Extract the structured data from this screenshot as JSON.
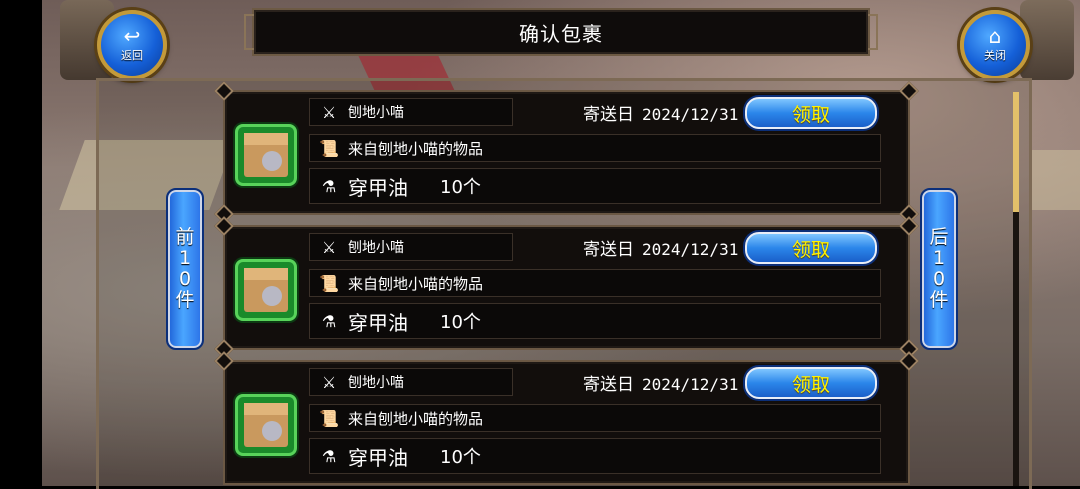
{
  "header": {
    "title": "确认包裹"
  },
  "back_button": {
    "label": "返回",
    "icon": "back-arrow-icon"
  },
  "close_button": {
    "label": "关闭",
    "icon": "home-icon"
  },
  "prev_button": {
    "label": "前10件"
  },
  "next_button": {
    "label": "后10件"
  },
  "date_label": "寄送日",
  "mails": [
    {
      "sender": "刨地小喵",
      "date": "2024/12/31",
      "claim_label": "领取",
      "subject": "来自刨地小喵的物品",
      "item": "穿甲油",
      "quantity": "10个"
    },
    {
      "sender": "刨地小喵",
      "date": "2024/12/31",
      "claim_label": "领取",
      "subject": "来自刨地小喵的物品",
      "item": "穿甲油",
      "quantity": "10个"
    },
    {
      "sender": "刨地小喵",
      "date": "2024/12/31",
      "claim_label": "领取",
      "subject": "来自刨地小喵的物品",
      "item": "穿甲油",
      "quantity": "10个"
    }
  ],
  "colors": {
    "claim_text": "#fff200",
    "button_blue": "#2b86ea",
    "frame_border": "#7d6a55",
    "package_green": "#58d35a"
  }
}
